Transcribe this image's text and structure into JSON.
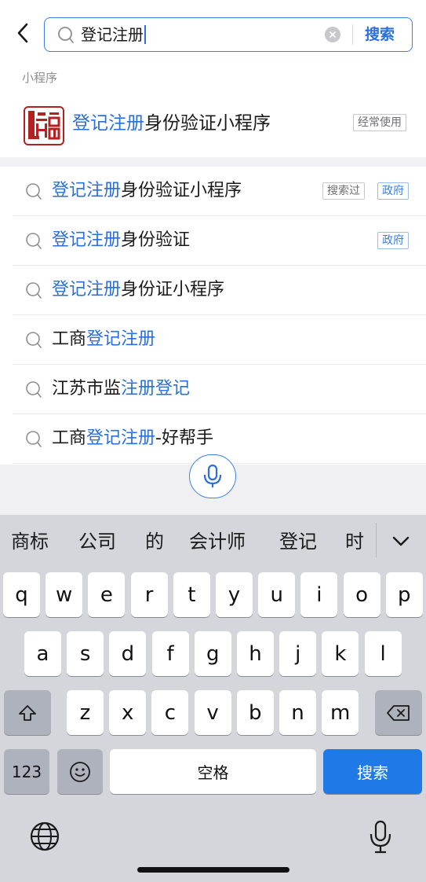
{
  "search": {
    "query": "登记注册",
    "button": "搜索"
  },
  "miniprogram_section": {
    "label": "小程序",
    "item": {
      "title_highlight": "登记注册",
      "title_rest": "身份验证小程序",
      "tag": "经常使用"
    }
  },
  "suggestions": [
    {
      "pre": "",
      "hl": "登记注册",
      "post": "身份验证小程序",
      "tags": [
        "搜索过",
        "政府"
      ]
    },
    {
      "pre": "",
      "hl": "登记注册",
      "post": "身份验证",
      "tags": [
        "政府"
      ]
    },
    {
      "pre": "",
      "hl": "登记注册",
      "post": "身份证小程序",
      "tags": []
    },
    {
      "pre": "工商",
      "hl": "登记注册",
      "post": "",
      "tags": []
    },
    {
      "pre": "江苏市监",
      "hl": "注册登记",
      "post": "",
      "tags": []
    },
    {
      "pre": "工商",
      "hl": "登记注册",
      "post": "-好帮手",
      "tags": []
    }
  ],
  "keyboard": {
    "candidates": [
      "商标",
      "公司",
      "的",
      "会计师",
      "登记",
      "时"
    ],
    "row1": [
      "q",
      "w",
      "e",
      "r",
      "t",
      "y",
      "u",
      "i",
      "o",
      "p"
    ],
    "row2": [
      "a",
      "s",
      "d",
      "f",
      "g",
      "h",
      "j",
      "k",
      "l"
    ],
    "row3": [
      "z",
      "x",
      "c",
      "v",
      "b",
      "n",
      "m"
    ],
    "num_key": "123",
    "space_key": "空格",
    "action_key": "搜索"
  },
  "colors": {
    "accent": "#2a6fdb",
    "keyboard_bg": "#d4d6dc",
    "action_key": "#1f7ae8"
  }
}
